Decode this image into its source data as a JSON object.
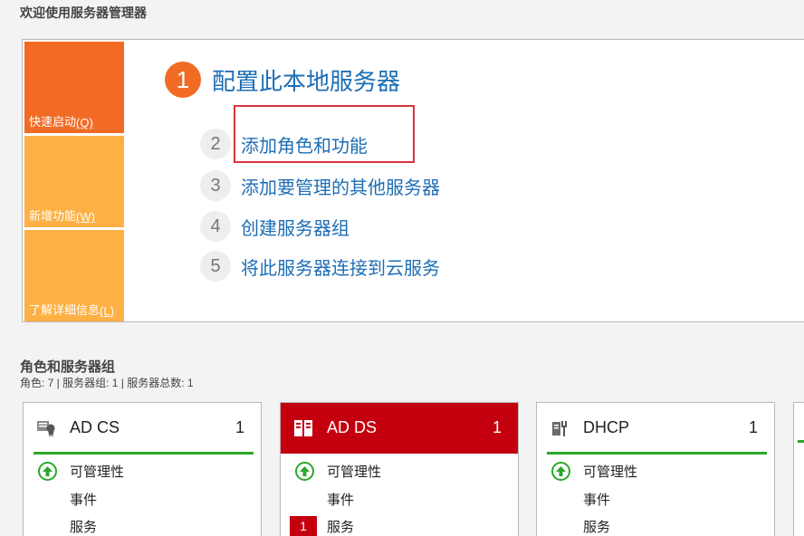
{
  "welcome": {
    "title": "欢迎使用服务器管理器",
    "tiles": [
      {
        "label": "快速启动",
        "accel": "(Q)"
      },
      {
        "label": "新增功能",
        "accel": "(W)"
      },
      {
        "label": "了解详细信息",
        "accel": "(L)"
      }
    ],
    "steps": [
      {
        "num": "1",
        "label": "配置此本地服务器"
      },
      {
        "num": "2",
        "label": "添加角色和功能"
      },
      {
        "num": "3",
        "label": "添加要管理的其他服务器"
      },
      {
        "num": "4",
        "label": "创建服务器组"
      },
      {
        "num": "5",
        "label": "将此服务器连接到云服务"
      }
    ]
  },
  "roles": {
    "title": "角色和服务器组",
    "summary": "角色: 7 | 服务器组: 1 | 服务器总数: 1",
    "cards": [
      {
        "title": "AD CS",
        "count": "1",
        "icon": "certificate-icon",
        "status": "可管理性",
        "events": "事件",
        "services": "服务"
      },
      {
        "title": "AD DS",
        "count": "1",
        "icon": "directory-icon",
        "status": "可管理性",
        "events": "事件",
        "services": "服务",
        "services_badge": "1"
      },
      {
        "title": "DHCP",
        "count": "1",
        "icon": "dhcp-icon",
        "status": "可管理性",
        "events": "事件",
        "services": "服务"
      }
    ]
  },
  "colors": {
    "accent_orange": "#f26b25",
    "tile_orange": "#fdb043",
    "link_blue": "#1e6eb5",
    "alert_red": "#c4000f",
    "ok_green": "#2aa82a"
  }
}
